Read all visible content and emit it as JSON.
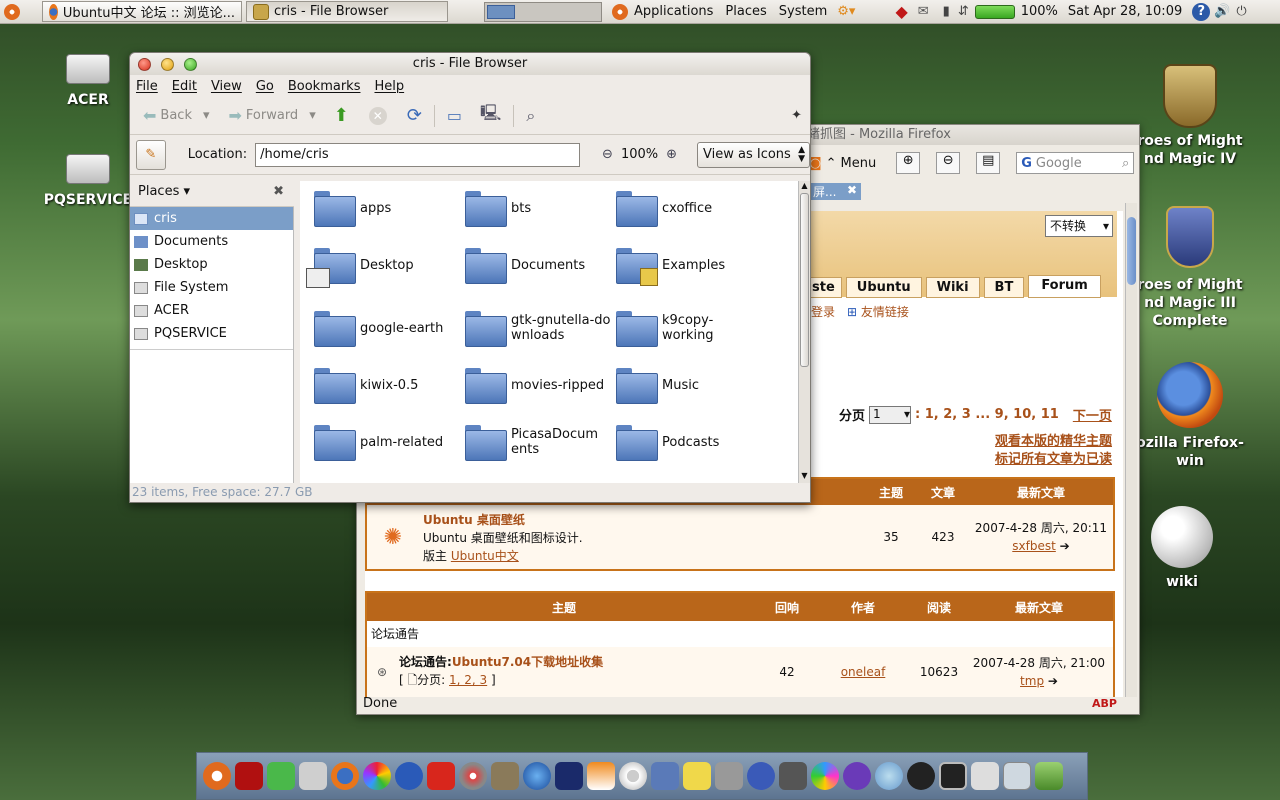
{
  "top_panel": {
    "tasks": [
      {
        "label": "Ubuntu中文 论坛 :: 浏览论..."
      },
      {
        "label": "cris - File Browser"
      }
    ],
    "menus": [
      "Applications",
      "Places",
      "System"
    ],
    "battery": "100%",
    "clock": "Sat Apr 28, 10:09"
  },
  "desktop": {
    "icons": [
      {
        "label": "ACER"
      },
      {
        "label": "PQSERVICE"
      }
    ],
    "right_icons": [
      {
        "label": "roes of Might\nnd Magic IV"
      },
      {
        "label": "roes of Might\nnd Magic III\nComplete"
      },
      {
        "label": "ozilla Firefox-\nwin"
      },
      {
        "label": "wiki"
      }
    ]
  },
  "firefox": {
    "title": "緖抓图 - Mozilla Firefox",
    "menu": "Menu",
    "search_placeholder": "Google",
    "tab_label": "屏...",
    "encoding_select": "不转换",
    "nav_tabs": [
      "ste",
      "Ubuntu",
      "Wiki",
      "BT",
      "Forum"
    ],
    "links": [
      "登录",
      "友情链接"
    ],
    "pager": {
      "label": "分页",
      "select": "1",
      "pages": ": 1, 2, 3 ... 9, 10, 11",
      "next": "下一页"
    },
    "forum_links": [
      "观看本版的精华主题",
      "标记所有文章为已读"
    ],
    "forum_head": [
      "主题",
      "文章",
      "最新文章"
    ],
    "forum_row": {
      "title": "Ubuntu 桌面壁纸",
      "desc": "Ubuntu 桌面壁纸和图标设计.",
      "mod_label": "版主",
      "mod": "Ubuntu中文",
      "topics": "35",
      "posts": "423",
      "last": "2007-4-28 周六, 20:11",
      "last_user": "sxfbest"
    },
    "topic_head": [
      "主题",
      "回响",
      "作者",
      "阅读",
      "最新文章"
    ],
    "section": "论坛通告",
    "topic_row": {
      "prefix": "论坛通告:",
      "title": "Ubuntu7.04下载地址收集",
      "pages_label": "[ 🗋分页:",
      "pages": "1, 2, 3",
      "end": "]",
      "replies": "42",
      "author": "oneleaf",
      "views": "10623",
      "last": "2007-4-28 周六, 21:00",
      "last_user": "tmp"
    },
    "status": "Done"
  },
  "file_browser": {
    "title": "cris - File Browser",
    "menus": [
      "File",
      "Edit",
      "View",
      "Go",
      "Bookmarks",
      "Help"
    ],
    "toolbar": {
      "back": "Back",
      "forward": "Forward"
    },
    "location_label": "Location:",
    "location_value": "/home/cris",
    "zoom": "100%",
    "view_mode": "View as Icons",
    "places_label": "Places",
    "places": [
      "cris",
      "Documents",
      "Desktop",
      "File System",
      "ACER",
      "PQSERVICE"
    ],
    "folders": [
      "apps",
      "bts",
      "cxoffice",
      "Desktop",
      "Documents",
      "Examples",
      "google-earth",
      "gtk-gnutella-downloads",
      "k9copy-working",
      "kiwix-0.5",
      "movies-ripped",
      "Music",
      "palm-related",
      "PicasaDocuments",
      "Podcasts"
    ],
    "status": "23 items, Free space: 27.7 GB"
  },
  "colors": {
    "accent": "#7b9ec8",
    "folder": "#4d76b8",
    "forum": "#b9661a"
  }
}
